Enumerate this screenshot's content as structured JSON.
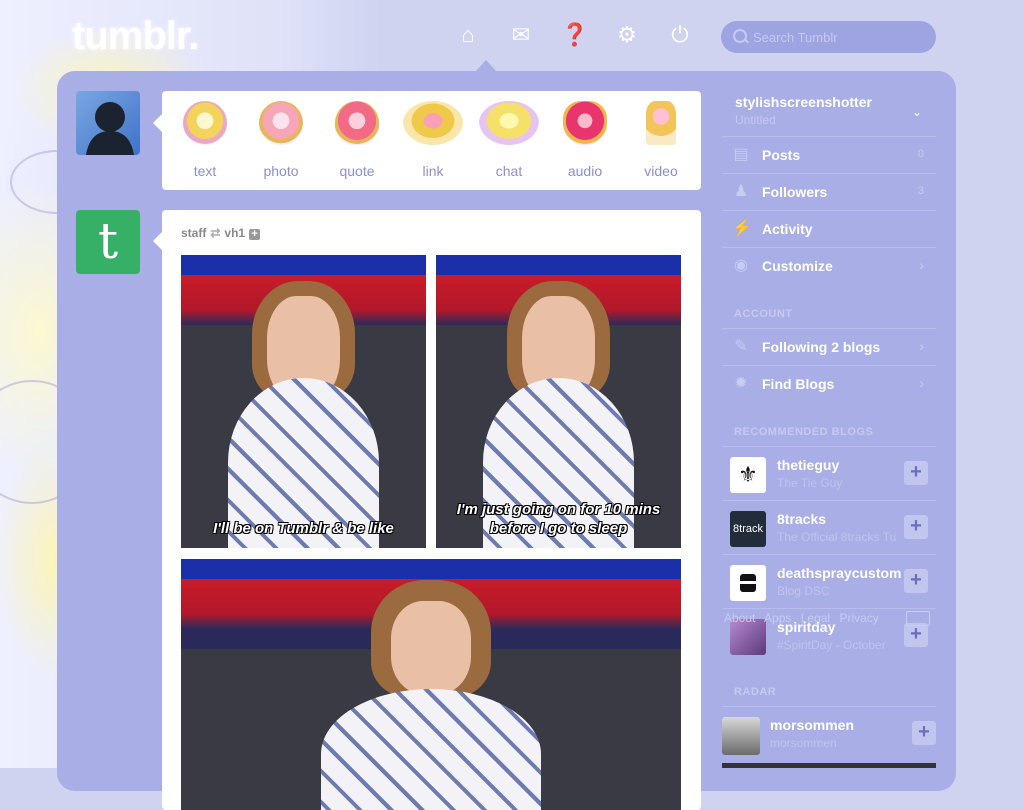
{
  "topbar": {
    "logo": "tumblr.",
    "search_placeholder": "Search Tumblr",
    "icons": [
      "home-icon",
      "mail-icon",
      "help-icon",
      "gear-icon",
      "power-icon"
    ]
  },
  "post_types": [
    {
      "label": "text",
      "color": "#f3d35c"
    },
    {
      "label": "photo",
      "color": "#f6a6b8"
    },
    {
      "label": "quote",
      "color": "#f26a86"
    },
    {
      "label": "link",
      "color": "#f0c94a"
    },
    {
      "label": "chat",
      "color": "#f5e06a"
    },
    {
      "label": "audio",
      "color": "#e8356e"
    },
    {
      "label": "video",
      "color": "#f2c45a"
    }
  ],
  "post": {
    "author": "staff",
    "reblogged_from": "vh1",
    "captions": [
      "I'll be on Tumblr & be like",
      "I'm just going on for 10 mins before I go to sleep"
    ]
  },
  "sidebar": {
    "blog_name": "stylishscreenshotter",
    "blog_subtitle": "Untitled",
    "rows": [
      {
        "label": "Posts",
        "count": "0"
      },
      {
        "label": "Followers",
        "count": "3"
      },
      {
        "label": "Activity",
        "count": ""
      },
      {
        "label": "Customize",
        "count": ""
      }
    ],
    "account_heading": "ACCOUNT",
    "account_rows": [
      {
        "label": "Following 2 blogs"
      },
      {
        "label": "Find Blogs"
      }
    ],
    "recommended_heading": "RECOMMENDED BLOGS",
    "recommended": [
      {
        "name": "thetieguy",
        "desc": "The Tie Guy",
        "thumb": "",
        "bg": "#ffffff"
      },
      {
        "name": "8tracks",
        "desc": "The Official 8tracks Tu",
        "thumb": "8track",
        "bg": "#222c3a"
      },
      {
        "name": "deathspraycustom",
        "desc": "Blog DSC",
        "thumb": "",
        "bg": "#ffffff"
      },
      {
        "name": "spiritday",
        "desc": "#SpiritDay - October",
        "thumb": "",
        "bg": "#8a5fa8"
      }
    ],
    "footer_links": [
      "About",
      "Apps",
      "Legal",
      "Privacy"
    ],
    "radar_heading": "RADAR",
    "radar": {
      "name": "morsommen",
      "desc": "morsommen"
    }
  }
}
